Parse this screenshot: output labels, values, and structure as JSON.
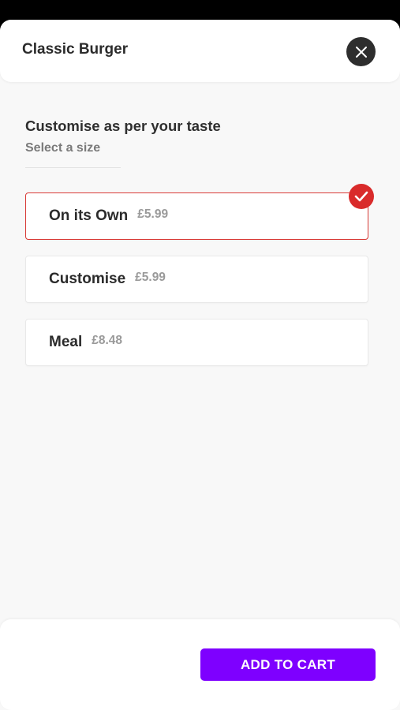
{
  "header": {
    "title": "Classic Burger",
    "close_icon": "close-icon"
  },
  "section": {
    "title": "Customise as per your taste",
    "subtitle": "Select a size"
  },
  "options": [
    {
      "label": "On its Own",
      "price": "£5.99",
      "selected": true
    },
    {
      "label": "Customise",
      "price": "£5.99",
      "selected": false
    },
    {
      "label": "Meal",
      "price": "£8.48",
      "selected": false
    }
  ],
  "footer": {
    "cart_label": "ADD TO CART"
  },
  "colors": {
    "accent": "#7e00ff",
    "selected_border": "#d93a36",
    "check_badge": "#d92b2b",
    "close_bg": "#2e2e2e"
  }
}
